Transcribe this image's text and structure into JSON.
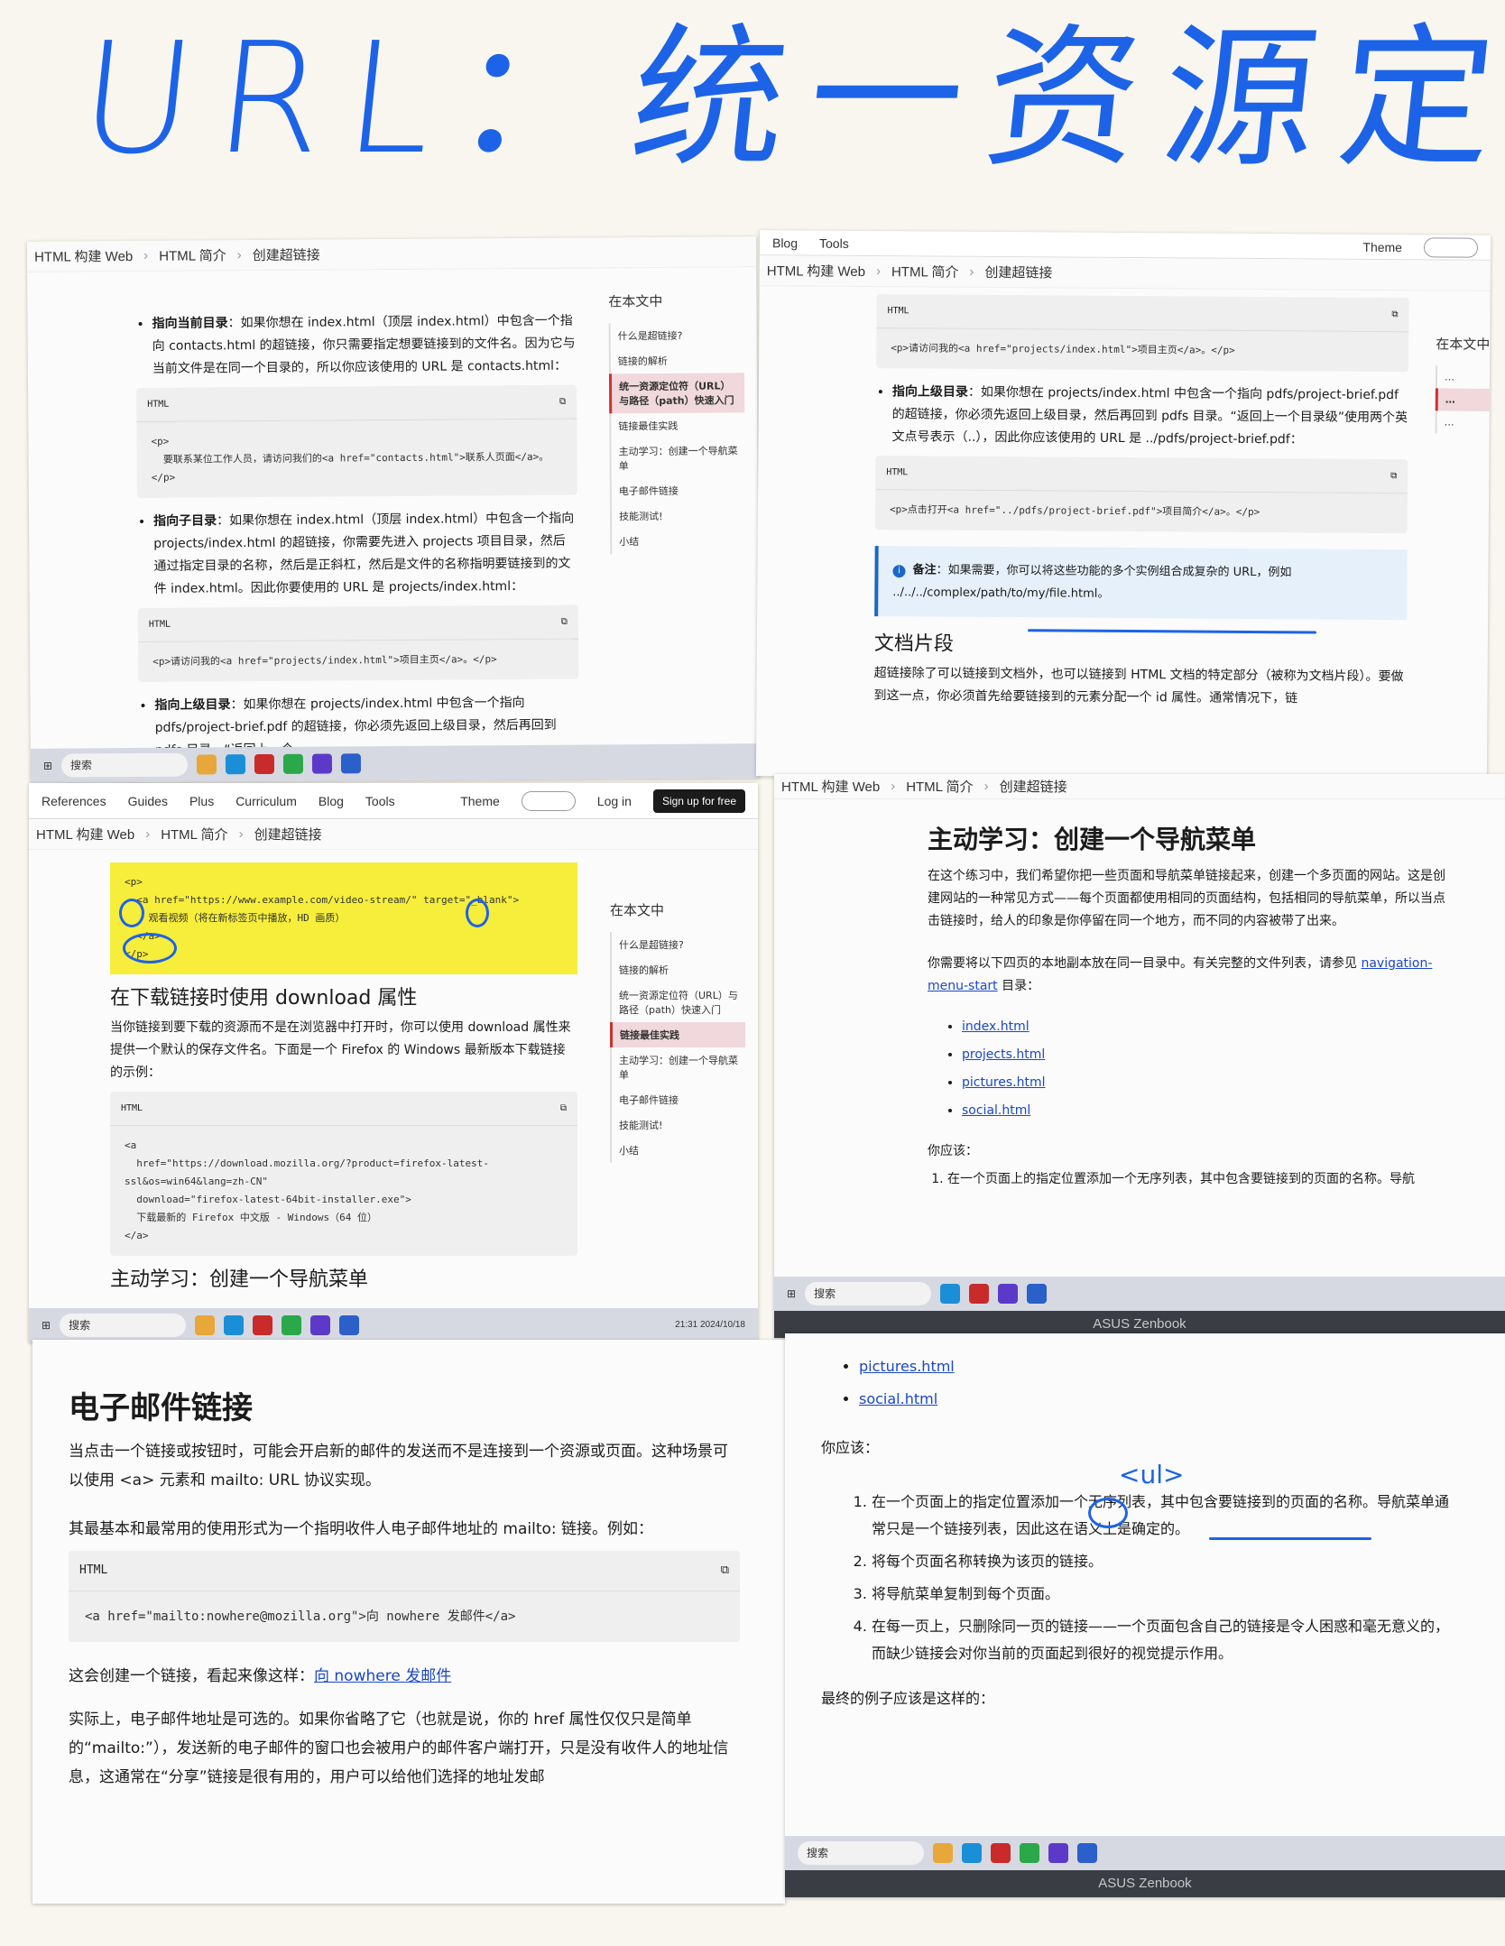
{
  "title": "URL：统一资源定位符",
  "crumbs": [
    "HTML 构建 Web",
    "HTML 简介",
    "创建超链接"
  ],
  "topnav": [
    "References",
    "Guides",
    "Plus",
    "Curriculum",
    "Blog",
    "Tools",
    "Theme",
    "Log in",
    "Sign up for free"
  ],
  "toc": {
    "heading": "在本文中",
    "items": [
      "什么是超链接?",
      "链接的解析",
      "统一资源定位符（URL）与路径（path）快速入门",
      "链接最佳实践",
      "主动学习：创建一个导航菜单",
      "电子邮件链接",
      "技能测试!",
      "小结"
    ]
  },
  "panel1": {
    "b1_label": "指向当前目录",
    "b1_text": "：如果你想在 index.html（顶层 index.html）中包含一个指向 contacts.html 的超链接，你只需要指定想要链接到的文件名。因为它与当前文件是在同一个目录的，所以你应该使用的 URL 是 contacts.html：",
    "code1_hd": "HTML",
    "code1": "<p>\n  要联系某位工作人员，请访问我们的<a href=\"contacts.html\">联系人页面</a>。\n</p>",
    "b2_label": "指向子目录",
    "b2_text": "：如果你想在 index.html（顶层 index.html）中包含一个指向 projects/index.html 的超链接，你需要先进入 projects 项目目录，然后通过指定目录的名称，然后是正斜杠，然后是文件的名称指明要链接到的文件 index.html。因此你要使用的 URL 是 projects/index.html：",
    "code2": "<p>请访问我的<a href=\"projects/index.html\">项目主页</a>。</p>",
    "b3_label": "指向上级目录",
    "b3_text": "：如果你想在 projects/index.html 中包含一个指向 pdfs/project-brief.pdf 的超链接，你必须先返回上级目录，然后再回到 pdfs 目录。“返回上一个"
  },
  "panel2": {
    "code0": "<p>请访问我的<a href=\"projects/index.html\">项目主页</a>。</p>",
    "b_label": "指向上级目录",
    "b_text": "：如果你想在 projects/index.html 中包含一个指向 pdfs/project-brief.pdf 的超链接，你必须先返回上级目录，然后再回到 pdfs 目录。“返回上一个目录级”使用两个英文点号表示（..），因此你应该使用的 URL 是 ../pdfs/project-brief.pdf：",
    "code1": "<p>点击打开<a href=\"../pdfs/project-brief.pdf\">项目简介</a>。</p>",
    "note_label": "备注",
    "note_text": "：如果需要，你可以将这些功能的多个实例组合成复杂的 URL，例如 ../../../complex/path/to/my/file.html。",
    "h2": "文档片段",
    "p": "超链接除了可以链接到文档外，也可以链接到 HTML 文档的特定部分（被称为文档片段）。要做到这一点，你必须首先给要链接到的元素分配一个 id 属性。通常情况下，链"
  },
  "panel3": {
    "code0": "<p>\n  <a href=\"https://www.example.com/video-stream/\" target=\"_blank\">\n    观看视频（将在新标签页中播放，HD 画质）\n  </a>\n</p>",
    "h2": "在下载链接时使用 download 属性",
    "p": "当你链接到要下载的资源而不是在浏览器中打开时，你可以使用 download 属性来提供一个默认的保存文件名。下面是一个 Firefox 的 Windows 最新版本下载链接的示例：",
    "code1": "<a\n  href=\"https://download.mozilla.org/?product=firefox-latest-ssl&os=win64&lang=zh-CN\"\n  download=\"firefox-latest-64bit-installer.exe\">\n  下载最新的 Firefox 中文版 - Windows（64 位）\n</a>",
    "h2b": "主动学习：创建一个导航菜单",
    "clock": "21:31 2024/10/18"
  },
  "panel4": {
    "h2": "主动学习：创建一个导航菜单",
    "p1": "在这个练习中，我们希望你把一些页面和导航菜单链接起来，创建一个多页面的网站。这是创建网站的一种常见方式——每个页面都使用相同的页面结构，包括相同的导航菜单，所以当点击链接时，给人的印象是你停留在同一个地方，而不同的内容被带了出来。",
    "p2_a": "你需要将以下四页的本地副本放在同一目录中。有关完整的文件列表，请参见 ",
    "p2_link": "navigation-menu-start",
    "p2_b": " 目录：",
    "files": [
      "index.html",
      "projects.html",
      "pictures.html",
      "social.html"
    ],
    "should": "你应该：",
    "step1": "在一个页面上的指定位置添加一个无序列表，其中包含要链接到的页面的名称。导航",
    "bezel": "ASUS Zenbook"
  },
  "panel5": {
    "h2": "电子邮件链接",
    "p1": "当点击一个链接或按钮时，可能会开启新的邮件的发送而不是连接到一个资源或页面。这种场景可以使用 <a> 元素和 mailto: URL 协议实现。",
    "p2": "其最基本和最常用的使用形式为一个指明收件人电子邮件地址的 mailto: 链接。例如：",
    "code": "<a href=\"mailto:nowhere@mozilla.org\">向 nowhere 发邮件</a>",
    "p3_a": "这会创建一个链接，看起来像这样：",
    "p3_link": "向 nowhere 发邮件",
    "p4": "实际上，电子邮件地址是可选的。如果你省略了它（也就是说，你的 href 属性仅仅只是简单的“mailto:”），发送新的电子邮件的窗口也会被用户的邮件客户端打开，只是没有收件人的地址信息，这通常在“分享”链接是很有用的，用户可以给他们选择的地址发邮"
  },
  "panel6": {
    "files": [
      "pictures.html",
      "social.html"
    ],
    "should": "你应该：",
    "steps": [
      "在一个页面上的指定位置添加一个无序列表，其中包含要链接到的页面的名称。导航菜单通常只是一个链接列表，因此这在语义上是确定的。",
      "将每个页面名称转换为该页的链接。",
      "将导航菜单复制到每个页面。",
      "在每一页上，只删除同一页的链接——一个页面包含自己的链接是令人困惑和毫无意义的，而缺少链接会对你当前的页面起到很好的视觉提示作用。"
    ],
    "final": "最终的例子应该是这样的：",
    "handwrite": "<ul>",
    "search": "搜索",
    "bezel": "ASUS Zenbook"
  },
  "taskbar_search": "搜索"
}
